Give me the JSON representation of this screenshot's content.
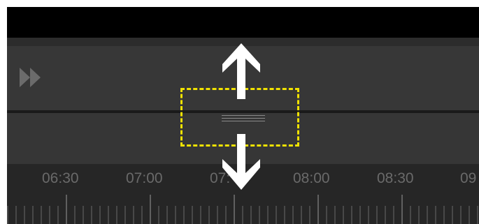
{
  "timeline": {
    "labels": [
      "06:30",
      "07:00",
      "07:",
      "08:00",
      "08:30",
      "09"
    ]
  },
  "icons": {
    "fast_forward": "fast-forward-icon",
    "resize_grip": "resize-grip-icon",
    "arrow_up": "arrow-up-icon",
    "arrow_down": "arrow-down-icon"
  },
  "colors": {
    "highlight": "#f1e200",
    "panel": "#373737",
    "timeline_bg": "#262626",
    "label": "#6a6a6a"
  }
}
